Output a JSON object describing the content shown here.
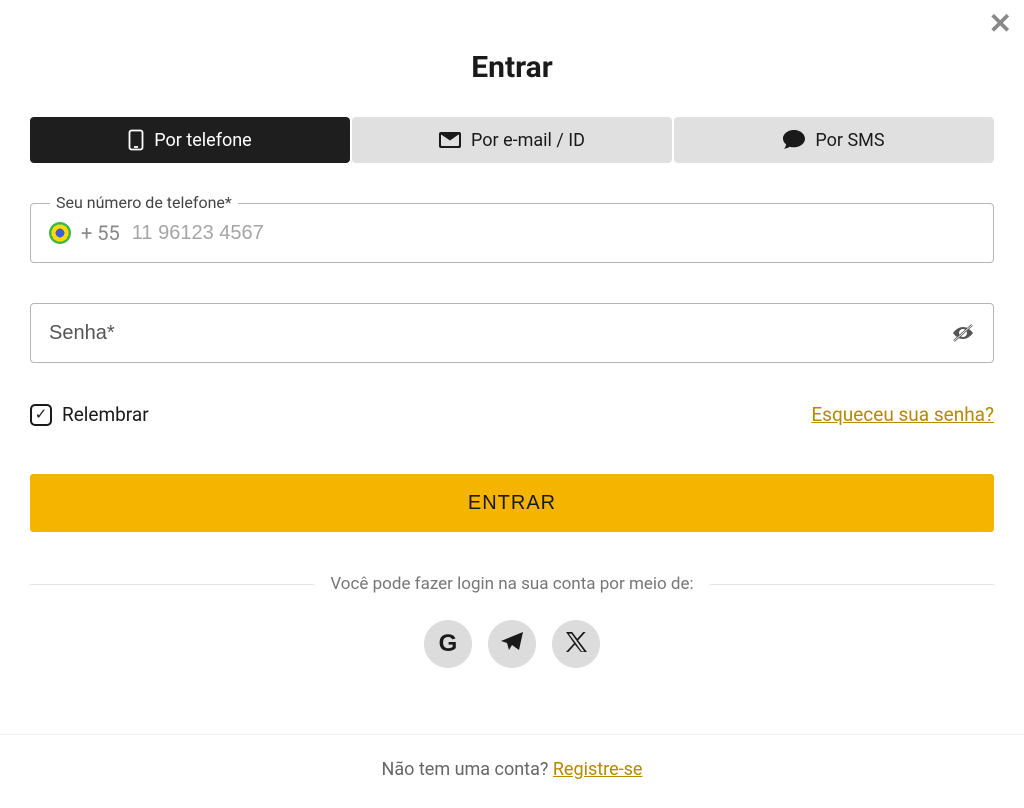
{
  "title": "Entrar",
  "tabs": {
    "phone": "Por telefone",
    "email": "Por e-mail / ID",
    "sms": "Por SMS"
  },
  "phone_field": {
    "label": "Seu número de telefone*",
    "prefix": "+ 55",
    "placeholder": "11 96123 4567"
  },
  "password_field": {
    "placeholder": "Senha*"
  },
  "remember_label": "Relembrar",
  "remember_checked": true,
  "forgot_label": "Esqueceu sua senha?",
  "submit_label": "ENTRAR",
  "social_divider": "Você pode fazer login na sua conta por meio de:",
  "footer_text": "Não tem uma conta? ",
  "register_label": "Registre-se"
}
